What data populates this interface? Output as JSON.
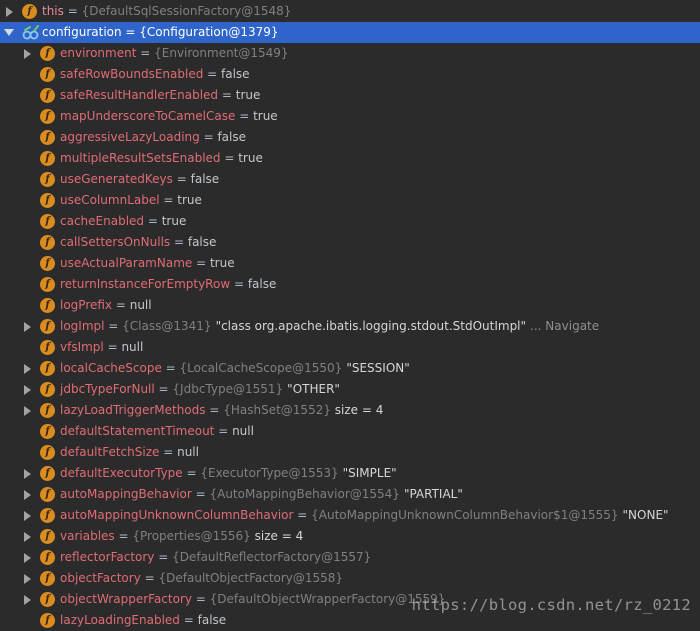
{
  "rows": [
    {
      "level": 0,
      "expander": "collapsed",
      "icon": "field",
      "name": "this",
      "ref": "{DefaultSqlSessionFactory@1548}",
      "value": "",
      "extra": "",
      "navigate": ""
    },
    {
      "level": 0,
      "expander": "expanded",
      "icon": "watch",
      "name": "configuration",
      "ref": "{Configuration@1379}",
      "value": "",
      "extra": "",
      "navigate": "",
      "selected": true
    },
    {
      "level": 1,
      "expander": "collapsed",
      "icon": "field",
      "name": "environment",
      "ref": "{Environment@1549}",
      "value": "",
      "extra": "",
      "navigate": ""
    },
    {
      "level": 1,
      "expander": "none",
      "icon": "field",
      "name": "safeRowBoundsEnabled",
      "ref": "",
      "value": "false",
      "extra": "",
      "navigate": ""
    },
    {
      "level": 1,
      "expander": "none",
      "icon": "field",
      "name": "safeResultHandlerEnabled",
      "ref": "",
      "value": "true",
      "extra": "",
      "navigate": ""
    },
    {
      "level": 1,
      "expander": "none",
      "icon": "field",
      "name": "mapUnderscoreToCamelCase",
      "ref": "",
      "value": "true",
      "extra": "",
      "navigate": ""
    },
    {
      "level": 1,
      "expander": "none",
      "icon": "field",
      "name": "aggressiveLazyLoading",
      "ref": "",
      "value": "false",
      "extra": "",
      "navigate": ""
    },
    {
      "level": 1,
      "expander": "none",
      "icon": "field",
      "name": "multipleResultSetsEnabled",
      "ref": "",
      "value": "true",
      "extra": "",
      "navigate": ""
    },
    {
      "level": 1,
      "expander": "none",
      "icon": "field",
      "name": "useGeneratedKeys",
      "ref": "",
      "value": "false",
      "extra": "",
      "navigate": ""
    },
    {
      "level": 1,
      "expander": "none",
      "icon": "field",
      "name": "useColumnLabel",
      "ref": "",
      "value": "true",
      "extra": "",
      "navigate": ""
    },
    {
      "level": 1,
      "expander": "none",
      "icon": "field",
      "name": "cacheEnabled",
      "ref": "",
      "value": "true",
      "extra": "",
      "navigate": ""
    },
    {
      "level": 1,
      "expander": "none",
      "icon": "field",
      "name": "callSettersOnNulls",
      "ref": "",
      "value": "false",
      "extra": "",
      "navigate": ""
    },
    {
      "level": 1,
      "expander": "none",
      "icon": "field",
      "name": "useActualParamName",
      "ref": "",
      "value": "true",
      "extra": "",
      "navigate": ""
    },
    {
      "level": 1,
      "expander": "none",
      "icon": "field",
      "name": "returnInstanceForEmptyRow",
      "ref": "",
      "value": "false",
      "extra": "",
      "navigate": ""
    },
    {
      "level": 1,
      "expander": "none",
      "icon": "field",
      "name": "logPrefix",
      "ref": "",
      "value": "null",
      "extra": "",
      "navigate": ""
    },
    {
      "level": 1,
      "expander": "collapsed",
      "icon": "field",
      "name": "logImpl",
      "ref": "{Class@1341}",
      "value": "",
      "extra": "\"class org.apache.ibatis.logging.stdout.StdOutImpl\"",
      "navigate": "... Navigate"
    },
    {
      "level": 1,
      "expander": "none",
      "icon": "field",
      "name": "vfsImpl",
      "ref": "",
      "value": "null",
      "extra": "",
      "navigate": ""
    },
    {
      "level": 1,
      "expander": "collapsed",
      "icon": "field",
      "name": "localCacheScope",
      "ref": "{LocalCacheScope@1550}",
      "value": "",
      "extra": "\"SESSION\"",
      "navigate": ""
    },
    {
      "level": 1,
      "expander": "collapsed",
      "icon": "field",
      "name": "jdbcTypeForNull",
      "ref": "{JdbcType@1551}",
      "value": "",
      "extra": "\"OTHER\"",
      "navigate": ""
    },
    {
      "level": 1,
      "expander": "collapsed",
      "icon": "field",
      "name": "lazyLoadTriggerMethods",
      "ref": "{HashSet@1552}",
      "value": "",
      "extra": " size = 4",
      "navigate": ""
    },
    {
      "level": 1,
      "expander": "none",
      "icon": "field",
      "name": "defaultStatementTimeout",
      "ref": "",
      "value": "null",
      "extra": "",
      "navigate": ""
    },
    {
      "level": 1,
      "expander": "none",
      "icon": "field",
      "name": "defaultFetchSize",
      "ref": "",
      "value": "null",
      "extra": "",
      "navigate": ""
    },
    {
      "level": 1,
      "expander": "collapsed",
      "icon": "field",
      "name": "defaultExecutorType",
      "ref": "{ExecutorType@1553}",
      "value": "",
      "extra": "\"SIMPLE\"",
      "navigate": ""
    },
    {
      "level": 1,
      "expander": "collapsed",
      "icon": "field",
      "name": "autoMappingBehavior",
      "ref": "{AutoMappingBehavior@1554}",
      "value": "",
      "extra": "\"PARTIAL\"",
      "navigate": ""
    },
    {
      "level": 1,
      "expander": "collapsed",
      "icon": "field",
      "name": "autoMappingUnknownColumnBehavior",
      "ref": "{AutoMappingUnknownColumnBehavior$1@1555}",
      "value": "",
      "extra": "\"NONE\"",
      "navigate": ""
    },
    {
      "level": 1,
      "expander": "collapsed",
      "icon": "field",
      "name": "variables",
      "ref": "{Properties@1556}",
      "value": "",
      "extra": " size = 4",
      "navigate": ""
    },
    {
      "level": 1,
      "expander": "collapsed",
      "icon": "field",
      "name": "reflectorFactory",
      "ref": "{DefaultReflectorFactory@1557}",
      "value": "",
      "extra": "",
      "navigate": ""
    },
    {
      "level": 1,
      "expander": "collapsed",
      "icon": "field",
      "name": "objectFactory",
      "ref": "{DefaultObjectFactory@1558}",
      "value": "",
      "extra": "",
      "navigate": ""
    },
    {
      "level": 1,
      "expander": "collapsed",
      "icon": "field",
      "name": "objectWrapperFactory",
      "ref": "{DefaultObjectWrapperFactory@1559}",
      "value": "",
      "extra": "",
      "navigate": ""
    },
    {
      "level": 1,
      "expander": "none",
      "icon": "field",
      "name": "lazyLoadingEnabled",
      "ref": "",
      "value": "false",
      "extra": "",
      "navigate": ""
    }
  ],
  "field_icon_letter": "f",
  "equals": " = ",
  "watermark": "https://blog.csdn.net/rz_0212",
  "colors": {
    "background": "#2b2b2b",
    "selection": "#2f65ca",
    "field_name": "#e06c75",
    "field_icon": "#d98c20",
    "ref_gray": "#808080"
  }
}
